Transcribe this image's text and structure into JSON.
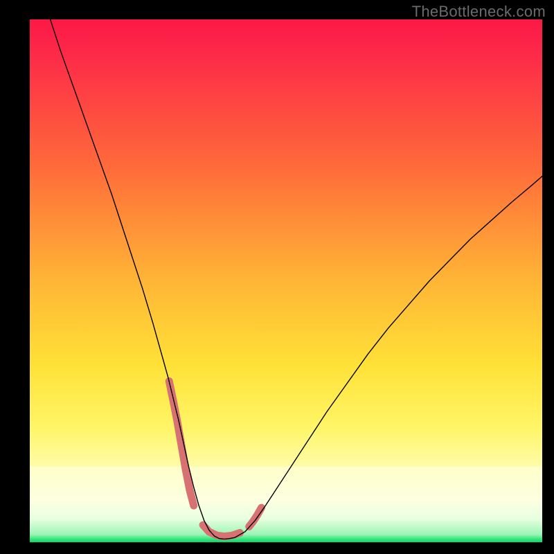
{
  "watermark": "TheBottleneck.com",
  "chart_data": {
    "type": "line",
    "title": "",
    "xlabel": "",
    "ylabel": "",
    "xlim": [
      0,
      100
    ],
    "ylim": [
      0,
      100
    ],
    "series": [
      {
        "name": "bottleneck-curve",
        "stroke": "#000000",
        "stroke_width": 1.4,
        "x": [
          4,
          6,
          8,
          10,
          12,
          14,
          16,
          18,
          20,
          22,
          24,
          26,
          27,
          28,
          29,
          30,
          31,
          32,
          33,
          34,
          35,
          36,
          37,
          38,
          39,
          40,
          42,
          44,
          46,
          48,
          50,
          54,
          58,
          62,
          66,
          70,
          74,
          78,
          82,
          86,
          90,
          94,
          98,
          100
        ],
        "y": [
          100,
          94,
          88.5,
          83,
          77.5,
          72,
          66.5,
          60.5,
          54.5,
          48.5,
          42,
          35,
          31.5,
          27.5,
          23.5,
          19,
          14.5,
          10.5,
          7,
          4.2,
          2.3,
          1.2,
          0.7,
          0.6,
          0.7,
          0.9,
          2,
          4.2,
          7,
          10,
          13,
          19,
          25,
          30.5,
          36,
          41,
          45.5,
          50,
          54,
          58,
          61.5,
          65,
          68.3,
          70
        ]
      },
      {
        "name": "salmon-highlight",
        "stroke": "#d87171",
        "stroke_width": 11,
        "linecap": "round",
        "segments_x": [
          [
            27.2,
            28.0,
            28.8,
            29.6,
            30.4,
            31.2,
            32.0
          ],
          [
            33.8,
            35.0,
            36.5,
            38.0,
            39.5,
            41.0
          ],
          [
            42.8,
            43.6,
            44.4,
            45.2
          ]
        ],
        "segments_y": [
          [
            30.8,
            27.0,
            23.0,
            18.5,
            14.0,
            10.0,
            7.0
          ],
          [
            3.3,
            2.0,
            1.3,
            1.1,
            1.3,
            1.8
          ],
          [
            3.0,
            4.0,
            5.2,
            6.6
          ]
        ]
      }
    ],
    "background_gradient": {
      "top": "#fc1847",
      "mid_top": "#ff6a3a",
      "mid": "#ffe137",
      "mid_low": "#fffb8a",
      "low_band_top": "#ffffe0",
      "low_band_bottom": "#cfffd4",
      "barrier_color": "#00e268"
    }
  }
}
